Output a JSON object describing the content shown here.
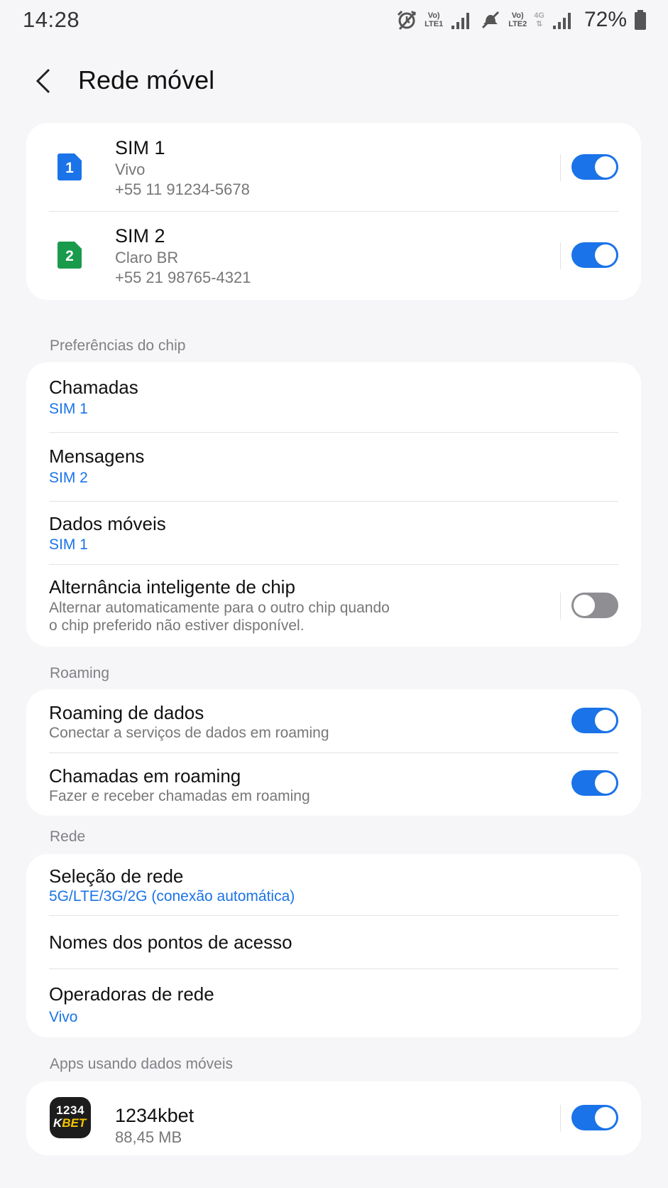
{
  "status_bar": {
    "time": "14:28",
    "volte1_top": "Vo)",
    "volte1_bottom": "LTE1",
    "volte2_top": "Vo)",
    "volte2_bottom": "LTE2",
    "net_tag": "4G",
    "battery": "72%"
  },
  "header": {
    "title": "Rede móvel"
  },
  "sims": [
    {
      "badge": "1",
      "title": "SIM 1",
      "carrier": "Vivo",
      "number": "+55 11 91234-5678",
      "color": "#1a73e8",
      "enabled": true
    },
    {
      "badge": "2",
      "title": "SIM 2",
      "carrier": "Claro BR",
      "number": "+55 21 98765-4321",
      "color": "#1a9a4b",
      "enabled": true
    }
  ],
  "chip_prefs": {
    "label": "Preferências do chip",
    "calls": {
      "title": "Chamadas",
      "value": "SIM 1"
    },
    "messages": {
      "title": "Mensagens",
      "value": "SIM 2"
    },
    "data": {
      "title": "Dados móveis",
      "value": "SIM 1"
    },
    "smart_switch": {
      "title": "Alternância inteligente de chip",
      "desc1": "Alternar automaticamente para o outro chip quando",
      "desc2": "o chip preferido não estiver disponível.",
      "enabled": false
    }
  },
  "roaming": {
    "label": "Roaming",
    "data_roaming": {
      "title": "Roaming de dados",
      "desc": "Conectar a serviços de dados em roaming",
      "enabled": true
    },
    "call_roaming": {
      "title": "Chamadas em roaming",
      "desc": "Fazer e receber chamadas em roaming",
      "enabled": true
    }
  },
  "network": {
    "label": "Rede",
    "mode": {
      "title": "Seleção de rede",
      "value": "5G/LTE/3G/2G (conexão automática)"
    },
    "apn": {
      "title": "Nomes dos pontos de acesso"
    },
    "operators": {
      "title": "Operadoras de rede",
      "value": "Vivo"
    }
  },
  "apps": {
    "label": "Apps usando dados móveis",
    "items": [
      {
        "name": "1234kbet",
        "usage": "88,45 MB",
        "icon_line1": "1234",
        "icon_line2_a": "K",
        "icon_line2_b": "BET",
        "enabled": true
      }
    ]
  },
  "colors": {
    "accent": "#1a73e8",
    "sim1": "#1a73e8",
    "sim2": "#1a9a4b",
    "toggle_off": "#8e8e93",
    "background": "#f6f6f8"
  }
}
